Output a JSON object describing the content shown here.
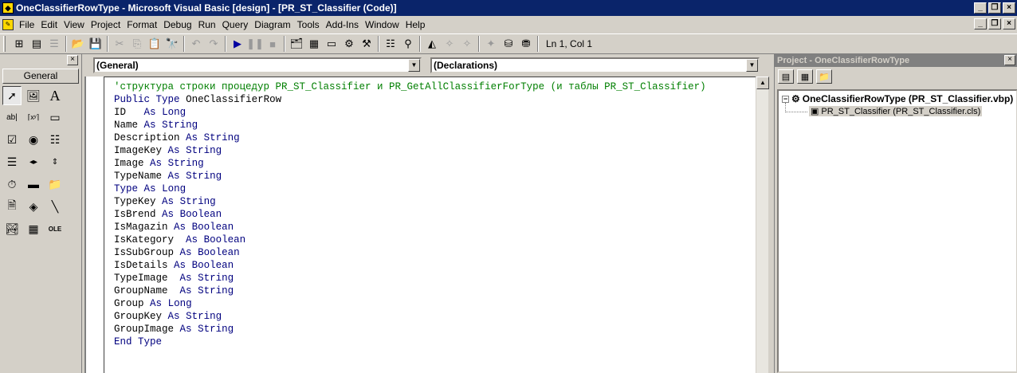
{
  "window": {
    "title": "OneClassifierRowType - Microsoft Visual Basic [design] - [PR_ST_Classifier (Code)]"
  },
  "menu": [
    "File",
    "Edit",
    "View",
    "Project",
    "Format",
    "Debug",
    "Run",
    "Query",
    "Diagram",
    "Tools",
    "Add-Ins",
    "Window",
    "Help"
  ],
  "toolbar": {
    "status": "Ln 1, Col 1"
  },
  "toolbox": {
    "tab_label": "General"
  },
  "editor": {
    "object_combo": "(General)",
    "proc_combo": "(Declarations)",
    "lines": [
      {
        "text": "'структура строки процедур PR_ST_Classifier и PR_GetAllClassifierForType (и таблы PR_ST_Classifier)",
        "type": "comment"
      },
      {
        "text": "Public Type OneClassifierRow",
        "type": "kw"
      },
      {
        "text": "ID   As Long",
        "type": "code"
      },
      {
        "text": "Name As String",
        "type": "code"
      },
      {
        "text": "Description As String",
        "type": "code"
      },
      {
        "text": "ImageKey As String",
        "type": "code"
      },
      {
        "text": "Image As String",
        "type": "code"
      },
      {
        "text": "TypeName As String",
        "type": "code"
      },
      {
        "text": "Type As Long",
        "type": "code"
      },
      {
        "text": "TypeKey As String",
        "type": "code"
      },
      {
        "text": "IsBrend As Boolean",
        "type": "code"
      },
      {
        "text": "IsMagazin As Boolean",
        "type": "code"
      },
      {
        "text": "IsKategory  As Boolean",
        "type": "code"
      },
      {
        "text": "IsSubGroup As Boolean",
        "type": "code"
      },
      {
        "text": "IsDetails As Boolean",
        "type": "code"
      },
      {
        "text": "TypeImage  As String",
        "type": "code"
      },
      {
        "text": "GroupName  As String",
        "type": "code"
      },
      {
        "text": "Group As Long",
        "type": "code"
      },
      {
        "text": "GroupKey As String",
        "type": "code"
      },
      {
        "text": "GroupImage As String",
        "type": "code"
      },
      {
        "text": "End Type",
        "type": "kw"
      }
    ]
  },
  "project": {
    "title": "Project - OneClassifierRowType",
    "root": "OneClassifierRowType (PR_ST_Classifier.vbp)",
    "child": "PR_ST_Classifier (PR_ST_Classifier.cls)"
  }
}
